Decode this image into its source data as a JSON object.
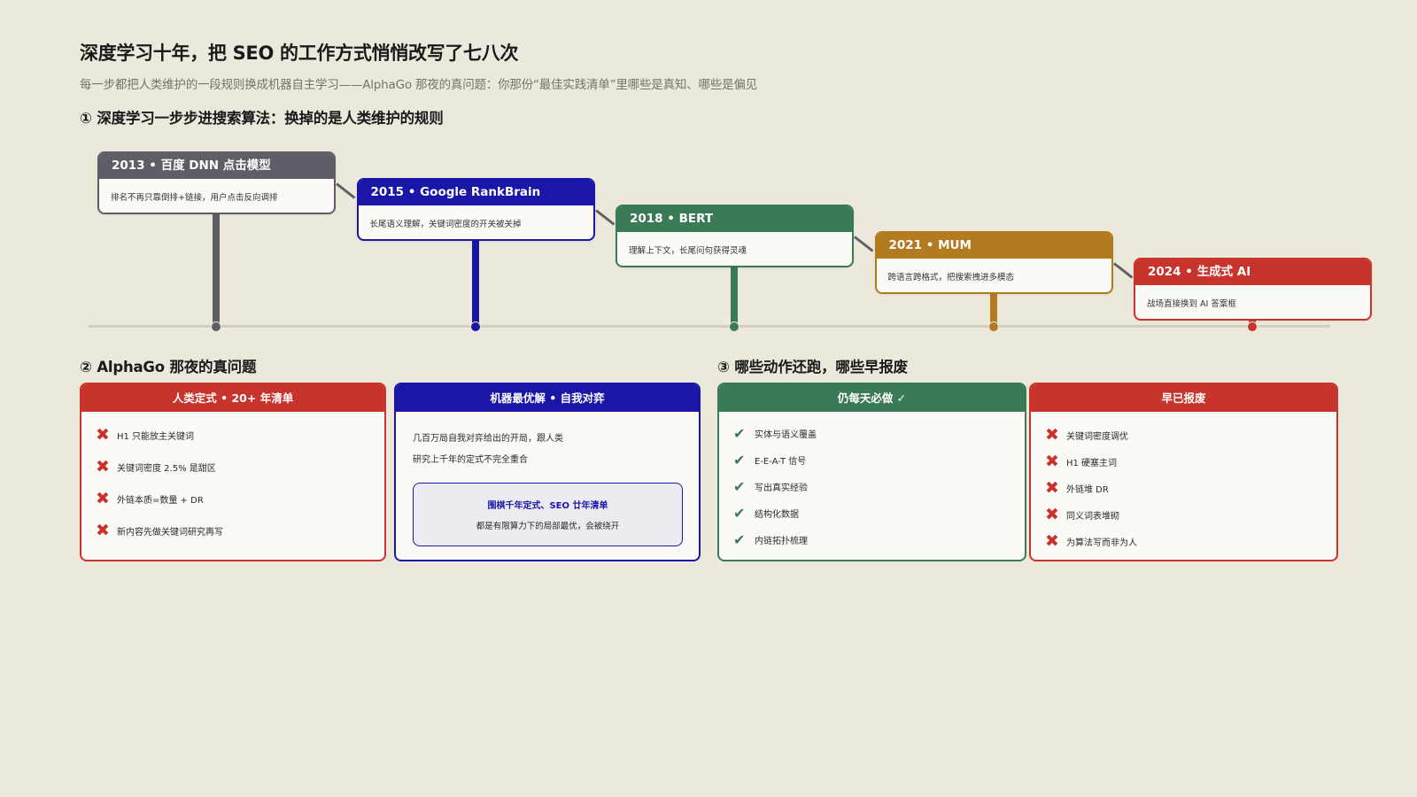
{
  "header": {
    "title": "深度学习十年，把 SEO 的工作方式悄悄改写了七八次",
    "subtitle": "每一步都把人类维护的一段规则换成机器自主学习——AlphaGo 那夜的真问题：你那份“最佳实践清单”里哪些是真知、哪些是偏见"
  },
  "sections": {
    "timeline": "① 深度学习一步步进搜索算法：换掉的是人类维护的规则",
    "alphago": "② AlphaGo 那夜的真问题",
    "actions": "③ 哪些动作还跑，哪些早报废"
  },
  "timeline": [
    {
      "title": "2013 • 百度 DNN 点击模型",
      "desc": "排名不再只靠倒排+链接，用户点击反向调排",
      "color": "#5f5e66"
    },
    {
      "title": "2015 • Google RankBrain",
      "desc": "长尾语义理解，关键词密度的开关被关掉",
      "color": "#1a17a8"
    },
    {
      "title": "2018 • BERT",
      "desc": "理解上下文，长尾问句获得灵魂",
      "color": "#3b7a57"
    },
    {
      "title": "2021 • MUM",
      "desc": "跨语言跨格式，把搜索拽进多模态",
      "color": "#b37b1f"
    },
    {
      "title": "2024 • 生成式 AI",
      "desc": "战场直接换到 AI 答案框",
      "color": "#c8332c"
    }
  ],
  "human_panel": {
    "header": "人类定式 • 20+ 年清单",
    "color": "#c8332c",
    "icon": "x-icon",
    "items": [
      "H1 只能放主关键词",
      "关键词密度 2.5% 是甜区",
      "外链本质=数量 + DR",
      "新内容先做关键词研究再写"
    ]
  },
  "machine_panel": {
    "header": "机器最优解 • 自我对弈",
    "color": "#1a17a8",
    "lines": [
      "几百万局自我对弈给出的开局，跟人类",
      "研究上千年的定式不完全重合"
    ],
    "box_title": "围棋千年定式、SEO 廿年清单",
    "box_body": "都是有限算力下的局部最优，会被绕开"
  },
  "still_panel": {
    "header": "仍每天必做 ✓",
    "color": "#3b7a57",
    "icon": "check-icon",
    "items": [
      "实体与语义覆盖",
      "E-E-A-T 信号",
      "写出真实经验",
      "结构化数据",
      "内链拓扑梳理"
    ]
  },
  "scrapped_panel": {
    "header": "早已报废",
    "color": "#c8332c",
    "icon": "x-icon",
    "items": [
      "关键词密度调优",
      "H1 硬塞主词",
      "外链堆 DR",
      "同义词表堆砌",
      "为算法写而非为人"
    ]
  }
}
